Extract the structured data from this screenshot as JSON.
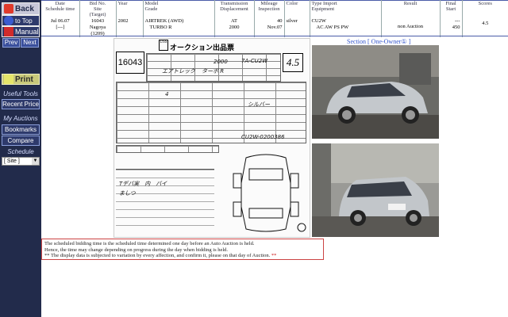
{
  "sidebar": {
    "back_label": "Back",
    "to_top_label": "to Top",
    "manual_label": "Manual",
    "prev_label": "Prev",
    "next_label": "Next",
    "print_label": "Print",
    "useful_tools_heading": "Useful Tools",
    "recent_price_label": "Recent Price",
    "my_auctions_heading": "My Auctions",
    "bookmarks_label": "Bookmarks",
    "compare_label": "Compare",
    "schedule_heading": "Schedule",
    "site_select_value": "[ Site ]"
  },
  "table": {
    "headers": {
      "date": [
        "Date",
        "Schedule time"
      ],
      "bid": [
        "Bid No.",
        "Site",
        "(Target)"
      ],
      "year": "Year",
      "model": [
        "Model",
        "Grade"
      ],
      "transmission": [
        "Transmission",
        "Displacement"
      ],
      "mileage": [
        "Mileage",
        "Inspection"
      ],
      "color": "Color",
      "type": [
        "Type  Import",
        "Equipment"
      ],
      "result": "Result",
      "final": [
        "Final",
        "Start"
      ],
      "scores": "Scores"
    },
    "row": {
      "date": "Jul 06.07",
      "schedule": "[---]",
      "bid_no": "16043",
      "site": "Nagoya",
      "target": "(1209)",
      "year": "2002",
      "model": "AIRTREK (AWD)",
      "grade": "TURBO R",
      "transmission": "AT",
      "displacement": "2000",
      "mileage": "40",
      "inspection": "Nov.07",
      "color": "silver",
      "type": "CU2W",
      "equipment": "AC AW PS PW",
      "result": "non Auction",
      "final": "---",
      "start": "450",
      "score": "4.5"
    }
  },
  "section_link": "Section [ One-Owner① ]",
  "sheet": {
    "title": "オークション出品票",
    "logo": "USS",
    "lot": "16043",
    "score": "4.5",
    "hw_model": "エアトレック",
    "hw_grade": "ターボ R",
    "hw_type": "7A-CU2W",
    "hw_disp": "2000",
    "hw_mileage": "4",
    "hw_color": "シルバー",
    "hw_chassis": "CU2W-0200386",
    "hw_notes_1": "Tデパ実　内　パイ",
    "hw_notes_2": "ましつ"
  },
  "notice": {
    "line1": "The scheduled bidding time is the scheduled time determined one day before an Auto Auction is held.",
    "line2": "Hence, the time may change depending on progress during the day when bidding is held.",
    "line3": "** The display data is subjected to variation by every affection, and confirm it, please on that day of Auction.",
    "line3_suffix": "**"
  }
}
